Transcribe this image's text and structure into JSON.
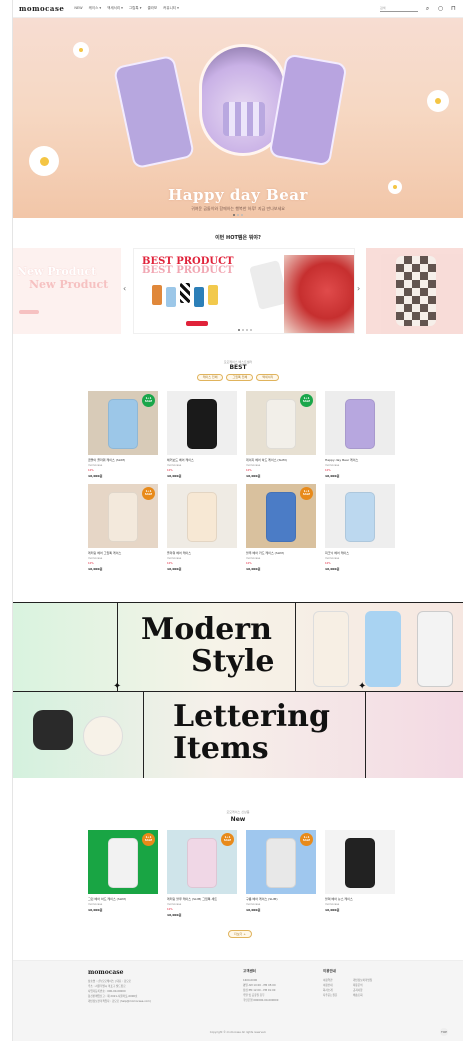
{
  "header": {
    "logo": "momocase",
    "nav": [
      "NEW",
      "케이스 ▾",
      "액세서리 ▾",
      "그립톡 ▾",
      "콜라보",
      "커뮤니티 ▾"
    ],
    "search_placeholder": "검색"
  },
  "hero": {
    "title": "Happy day Bear",
    "subtitle": "귀여운 곰돌이와 함께하는 행복한 하루! 지금 만나보세요"
  },
  "hot": {
    "title": "이번 HOT템은 뭐야?",
    "best_product_1": "BEST PRODUCT",
    "best_product_2": "BEST PRODUCT",
    "new_product_1": "New Product",
    "new_product_2": "New Product"
  },
  "best": {
    "subtitle": "모모케이스 베스트셀러",
    "title": "BEST",
    "filters": [
      "케이스 전체",
      "그립톡 전체",
      "액세서리"
    ],
    "products": [
      {
        "name": "곰돌이 플라워 케이스 (SLIM)",
        "brand": "momocase",
        "discount": "10%",
        "price": "16,000원",
        "badge": "1+1 SALE",
        "badge_color": "#1aa64a",
        "img_bg": "#d8cbb8",
        "accent": "#9cc7e8"
      },
      {
        "name": "체커보드 베어 케이스",
        "brand": "momocase",
        "discount": "10%",
        "price": "16,000원",
        "badge": "",
        "badge_color": "",
        "img_bg": "#efefef",
        "accent": "#1a1a1a"
      },
      {
        "name": "데이지 베어 하드 케이스 (SLIM)",
        "brand": "momocase",
        "discount": "10%",
        "price": "16,000원",
        "badge": "1+1 SALE",
        "badge_color": "#1aa64a",
        "img_bg": "#e7e0d2",
        "accent": "#f2efe9"
      },
      {
        "name": "Happy day Bear 케이스",
        "brand": "momocase",
        "discount": "10%",
        "price": "16,000원",
        "badge": "",
        "badge_color": "",
        "img_bg": "#ededed",
        "accent": "#b7a7df"
      },
      {
        "name": "레터링 베어 그립톡 케이스",
        "brand": "momocase",
        "discount": "10%",
        "price": "16,000원",
        "badge": "1+1 SALE",
        "badge_color": "#e88a1a",
        "img_bg": "#e6d6c6",
        "accent": "#f3e9dc"
      },
      {
        "name": "플라워 베어 케이스",
        "brand": "momocase",
        "discount": "10%",
        "price": "16,000원",
        "badge": "",
        "badge_color": "",
        "img_bg": "#efebe4",
        "accent": "#f7e8d4"
      },
      {
        "name": "블루 베어 카드 케이스 (SLIM)",
        "brand": "momocase",
        "discount": "10%",
        "price": "16,000원",
        "badge": "1+1 SALE",
        "badge_color": "#e88a1a",
        "img_bg": "#d9c19e",
        "accent": "#4b7cc6"
      },
      {
        "name": "피크닉 베어 케이스",
        "brand": "momocase",
        "discount": "10%",
        "price": "16,000원",
        "badge": "",
        "badge_color": "",
        "img_bg": "#eeeeee",
        "accent": "#bcd8ef"
      }
    ]
  },
  "banners": {
    "modern_1": "Modern",
    "modern_2": "Style",
    "lettering_1": "Lettering",
    "lettering_2": "Items"
  },
  "new": {
    "subtitle": "모모케이스 신상품",
    "title": "New",
    "products": [
      {
        "name": "그린 베어 하드 케이스 (SLIM)",
        "brand": "momocase",
        "discount": "",
        "price": "16,000원",
        "badge": "1+1 SALE",
        "badge_color": "#e88a1a",
        "img_bg": "#19a544",
        "accent": "#f2f2f2"
      },
      {
        "name": "레터링 블루 케이스 (SLIM) 그립톡 세트",
        "brand": "momocase",
        "discount": "10%",
        "price": "16,000원",
        "badge": "1+1 SALE",
        "badge_color": "#e88a1a",
        "img_bg": "#cfe4ea",
        "accent": "#f0d7e6"
      },
      {
        "name": "구름 베어 케이스 (SLIM)",
        "brand": "momocase",
        "discount": "",
        "price": "16,000원",
        "badge": "1+1 SALE",
        "badge_color": "#e88a1a",
        "img_bg": "#9fc7ee",
        "accent": "#e8e8e8"
      },
      {
        "name": "블랙 베어 뉴스 케이스",
        "brand": "momocase",
        "discount": "",
        "price": "16,000원",
        "badge": "",
        "badge_color": "",
        "img_bg": "#f3f3f3",
        "accent": "#222222"
      }
    ],
    "more_label": "더보기 +"
  },
  "footer": {
    "logo": "momocase",
    "company_lines": [
      "상호명 : (주)모모케이스 | 대표 : 김모모",
      "주소 : 서울특별시 마포구 월드컵로",
      "사업자등록번호 : 000-00-00000",
      "통신판매업신고 : 제 2021-서울마포-0000호",
      "개인정보관리책임자 : 김모모 (help@momocase.com)"
    ],
    "cs_title": "고객센터",
    "cs_lines": [
      "1600-0000",
      "평일 AM 10:00 - PM 05:00",
      "점심 PM 12:00 - PM 01:00",
      "주말 및 공휴일 휴무",
      "국민은행 000000-00-000000"
    ],
    "info_title": "이용안내",
    "info_links": [
      "이용약관",
      "개인정보처리방침",
      "이용안내",
      "제휴문의",
      "회사소개",
      "공지사항",
      "자주묻는질문",
      "배송조회"
    ],
    "copyright": "Copyright © momocase All rights reserved."
  },
  "top_button": "TOP"
}
